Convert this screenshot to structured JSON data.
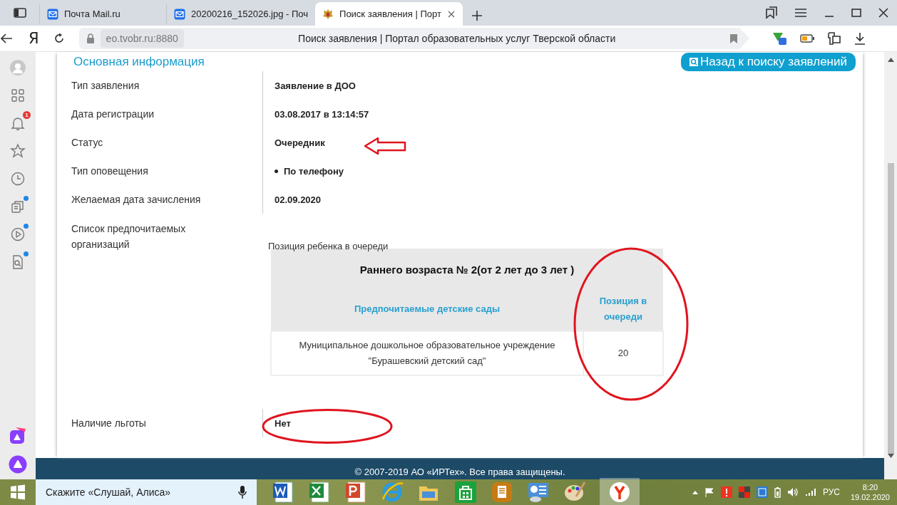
{
  "browser": {
    "tabs": [
      {
        "title": "Почта Mail.ru",
        "kind": "mail",
        "selected": false
      },
      {
        "title": "20200216_152026.jpg - Поч",
        "kind": "mail",
        "selected": false
      },
      {
        "title": "Поиск заявления | Порт",
        "kind": "site",
        "selected": true
      }
    ],
    "logo": "Я",
    "address": {
      "domain": "eo.tvobr.ru:8880",
      "page_title": "Поиск заявления | Портал образовательных услуг Тверской области"
    }
  },
  "sidebar": {
    "items": [
      {
        "kind": "profile",
        "dot": false
      },
      {
        "kind": "apps",
        "dot": false
      },
      {
        "kind": "notifications",
        "dot": false,
        "badge": "1"
      },
      {
        "kind": "bookmarks",
        "dot": false
      },
      {
        "kind": "history",
        "dot": false
      },
      {
        "kind": "collections",
        "dot": true
      },
      {
        "kind": "video",
        "dot": true
      },
      {
        "kind": "lens",
        "dot": true
      }
    ]
  },
  "page": {
    "heading": "Основная информация",
    "back_button": "Назад к поиску заявлений",
    "fields": [
      {
        "kind": "text",
        "label": "Тип заявления",
        "value": "Заявление в ДОО"
      },
      {
        "kind": "text",
        "label": "Дата регистрации",
        "value": "03.08.2017 в 13:14:57"
      },
      {
        "kind": "text",
        "label": "Статус",
        "value": "Очередник"
      },
      {
        "kind": "bullet",
        "label": "Тип оповещения",
        "value": "По телефону"
      },
      {
        "kind": "text",
        "label": "Желаемая дата зачисления",
        "value": "02.09.2020"
      },
      {
        "kind": "table",
        "label": "Список предпочитаемых организаций",
        "table": {
          "caption": "Позиция ребенка в очереди",
          "group": "Раннего возраста № 2(от 2 лет до 3 лет )",
          "columns": [
            "Предпочитаемые детские сады",
            "Позиция в очереди"
          ],
          "rows": [
            [
              "Муниципальное дошкольное образовательное учреждение \"Бурашевский детский сад\"",
              "20"
            ]
          ]
        }
      },
      {
        "kind": "text",
        "label": "Наличие льготы",
        "value": "Нет"
      }
    ]
  },
  "footer": "© 2007-2019 АО «ИРТех». Все права защищены.",
  "taskbar": {
    "search_placeholder": "Скажите «Слушай, Алиса»",
    "language": "РУС",
    "time": "8:20",
    "date": "19.02.2020"
  }
}
